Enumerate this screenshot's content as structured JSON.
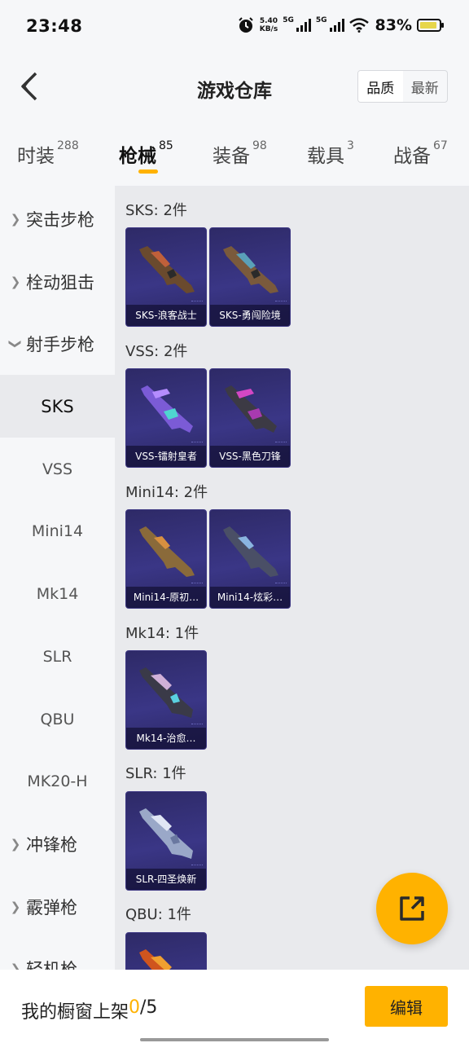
{
  "status_bar": {
    "time": "23:48",
    "net_speed_value": "5.40",
    "net_speed_unit": "KB/s",
    "signal_1_label": "5G",
    "signal_2_label": "5G",
    "battery_percent": "83%"
  },
  "header": {
    "title": "游戏仓库",
    "sort_options": [
      "品质",
      "最新"
    ],
    "active_sort": "品质"
  },
  "tabs": [
    {
      "label": "时装",
      "count": "288"
    },
    {
      "label": "枪械",
      "count": "85"
    },
    {
      "label": "装备",
      "count": "98"
    },
    {
      "label": "载具",
      "count": "3"
    },
    {
      "label": "战备",
      "count": "67"
    }
  ],
  "active_tab": "枪械",
  "sidebar": {
    "items": [
      {
        "label": "突击步枪",
        "type": "group",
        "expanded": false
      },
      {
        "label": "栓动狙击",
        "type": "group",
        "expanded": false
      },
      {
        "label": "射手步枪",
        "type": "group",
        "expanded": true
      },
      {
        "label": "SKS",
        "type": "sub",
        "selected": true
      },
      {
        "label": "VSS",
        "type": "sub"
      },
      {
        "label": "Mini14",
        "type": "sub"
      },
      {
        "label": "Mk14",
        "type": "sub"
      },
      {
        "label": "SLR",
        "type": "sub"
      },
      {
        "label": "QBU",
        "type": "sub"
      },
      {
        "label": "MK20-H",
        "type": "sub"
      },
      {
        "label": "冲锋枪",
        "type": "group",
        "expanded": false
      },
      {
        "label": "霰弹枪",
        "type": "group",
        "expanded": false
      },
      {
        "label": "轻机枪",
        "type": "group",
        "expanded": false
      }
    ]
  },
  "sections": [
    {
      "title": "SKS: 2件",
      "items": [
        "SKS-浪客战士",
        "SKS-勇闯险境"
      ]
    },
    {
      "title": "VSS: 2件",
      "items": [
        "VSS-镭射皇者",
        "VSS-黑色刀锋"
      ]
    },
    {
      "title": "Mini14: 2件",
      "items": [
        "Mini14-原初…",
        "Mini14-炫彩…"
      ]
    },
    {
      "title": "Mk14: 1件",
      "items": [
        "Mk14-治愈…"
      ]
    },
    {
      "title": "SLR: 1件",
      "items": [
        "SLR-四圣焕新"
      ]
    },
    {
      "title": "QBU: 1件",
      "items": [
        ""
      ]
    }
  ],
  "bottom_bar": {
    "shelf_label": "我的橱窗上架",
    "shelf_count": "0",
    "shelf_total": "/5",
    "edit_label": "编辑"
  },
  "colors": {
    "accent": "#ffb200",
    "card_bg": "#35317a",
    "page_bg": "#f6f7f9",
    "content_bg": "#e9eaed"
  }
}
